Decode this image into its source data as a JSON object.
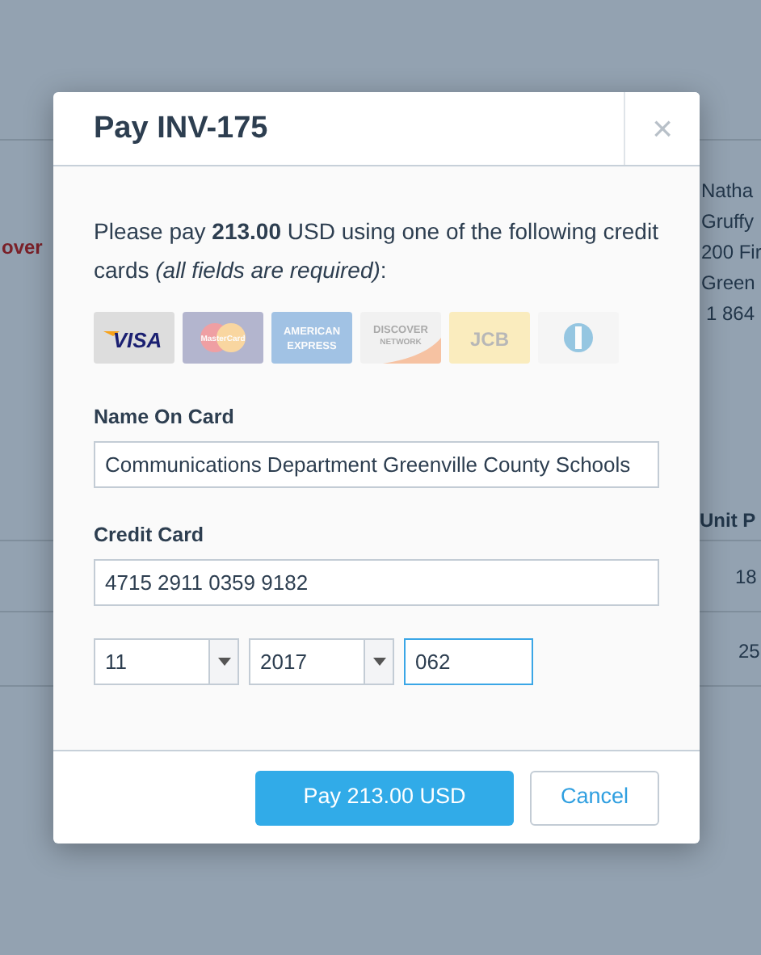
{
  "background": {
    "left_text": "over",
    "contact_lines": [
      "Natha",
      "Gruffy",
      "200 Fir",
      "Green",
      "1 864"
    ],
    "column_heading": "Unit P",
    "cells": [
      "18",
      "25"
    ]
  },
  "modal": {
    "title": "Pay INV-175",
    "close": "×",
    "intro": "Please pay **213.00** USD using one of the following credit cards *(all fields are required)*:",
    "cards": [
      {
        "kind": "visa",
        "label": "VISA",
        "selected": true
      },
      {
        "kind": "mastercard",
        "label": "MasterCard",
        "selected": false
      },
      {
        "kind": "amex",
        "label": "AMERICAN EXPRESS",
        "selected": false
      },
      {
        "kind": "discover",
        "label": "DISCOVER",
        "sublabel": "NETWORK",
        "selected": false
      },
      {
        "kind": "jcb",
        "label": "JCB",
        "selected": false
      },
      {
        "kind": "diners",
        "selected": false
      }
    ],
    "fields": [
      {
        "label": "Name On Card",
        "value": "Communications Department Greenville County Schools"
      },
      {
        "label": "Credit Card",
        "value": "4715 2911 0359 9182"
      }
    ],
    "expiry_month": "11",
    "expiry_year": "2017",
    "cvc": {
      "value": "062",
      "focused": true
    },
    "buttons": [
      {
        "kind": "primary",
        "label": "Pay 213.00 USD"
      },
      {
        "kind": "secondary",
        "label": "Cancel"
      }
    ]
  }
}
